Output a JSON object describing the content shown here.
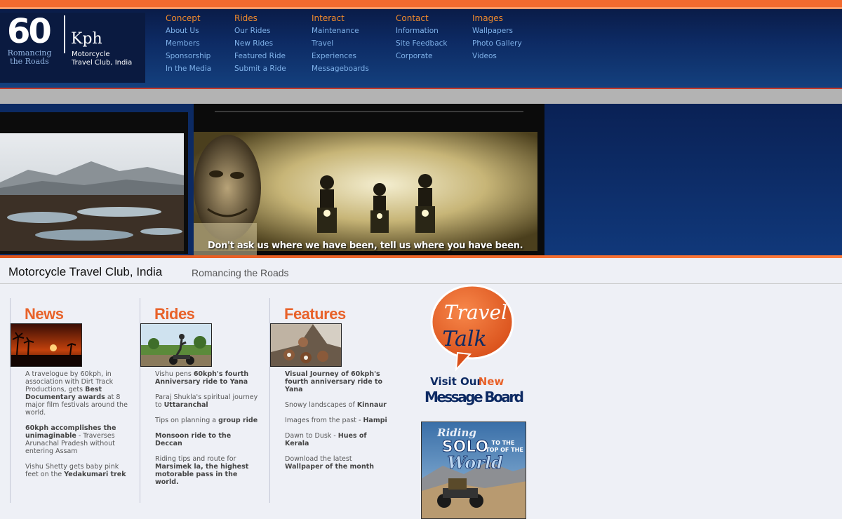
{
  "logo": {
    "number": "60",
    "unit": "Kph",
    "tagline_line1": "Romancing",
    "tagline_line2": "the Roads",
    "subtitle_line1": "Motorcycle",
    "subtitle_line2": "Travel Club, India"
  },
  "nav": {
    "concept": {
      "heading": "Concept",
      "links": [
        "About Us",
        "Members",
        "Sponsorship",
        "In the Media"
      ]
    },
    "rides": {
      "heading": "Rides",
      "links": [
        "Our Rides",
        "New Rides",
        "Featured Ride",
        "Submit a Ride"
      ]
    },
    "interact": {
      "heading": "Interact",
      "links": [
        "Maintenance",
        "Travel",
        "Experiences",
        "Messageboards"
      ]
    },
    "contact": {
      "heading": "Contact",
      "links": [
        "Information",
        "Site Feedback",
        "Corporate"
      ]
    },
    "images": {
      "heading": "Images",
      "links": [
        "Wallpapers",
        "Photo Gallery",
        "Videos"
      ]
    }
  },
  "banner": {
    "slogan": "Don't ask us where we have been, tell us where you have been."
  },
  "page": {
    "title": "Motorcycle Travel Club, India",
    "tagline": "Romancing the Roads"
  },
  "news": {
    "title": "News",
    "items": [
      {
        "pre": "A travelogue by 60kph, in association with Dirt Track Productions, gets ",
        "bold": "Best Documentary awards",
        "post": " at 8 major film festivals around the world."
      },
      {
        "pre": "",
        "bold": "60kph accomplishes the unimaginable",
        "post": " - Traverses Arunachal Pradesh without entering Assam"
      },
      {
        "pre": "Vishu Shetty gets baby pink feet on the ",
        "bold": "Yedakumari trek",
        "post": ""
      }
    ]
  },
  "rides": {
    "title": "Rides",
    "items": [
      {
        "pre": "Vishu pens ",
        "bold": "60kph's fourth Anniversary ride to Yana",
        "post": ""
      },
      {
        "pre": "Paraj Shukla's spiritual journey to ",
        "bold": "Uttaranchal",
        "post": ""
      },
      {
        "pre": "Tips on planning a ",
        "bold": "group ride",
        "post": ""
      },
      {
        "pre": "",
        "bold": "Monsoon ride to the Deccan",
        "post": ""
      },
      {
        "pre": "Riding tips and route for ",
        "bold": "Marsimek la, the highest motorable pass in the world.",
        "post": ""
      }
    ]
  },
  "features": {
    "title": "Features",
    "items": [
      {
        "pre": "",
        "bold": "Visual Journey of 60kph's fourth anniversary ride to Yana",
        "post": ""
      },
      {
        "pre": "Snowy landscapes of ",
        "bold": "Kinnaur",
        "post": ""
      },
      {
        "pre": "Images from the past - ",
        "bold": "Hampi",
        "post": ""
      },
      {
        "pre": "Dawn to Dusk - ",
        "bold": "Hues of Kerala",
        "post": ""
      },
      {
        "pre": "Download the latest ",
        "bold": "Wallpaper of the month",
        "post": ""
      }
    ]
  },
  "ads": {
    "travel_talk_line1": "Travel",
    "travel_talk_line2": "Talk",
    "visit_our": "Visit Our",
    "new": "New",
    "message_board": "Message Board",
    "solo_riding": "Riding",
    "solo_solo": "SOLO",
    "solo_to_the": "TO THE",
    "solo_top_of_the": "TOP OF THE",
    "solo_world": "World"
  },
  "colors": {
    "accent_orange": "#e8622a",
    "nav_link_blue": "#7fb2ea",
    "header_navy": "#0d2a63"
  }
}
